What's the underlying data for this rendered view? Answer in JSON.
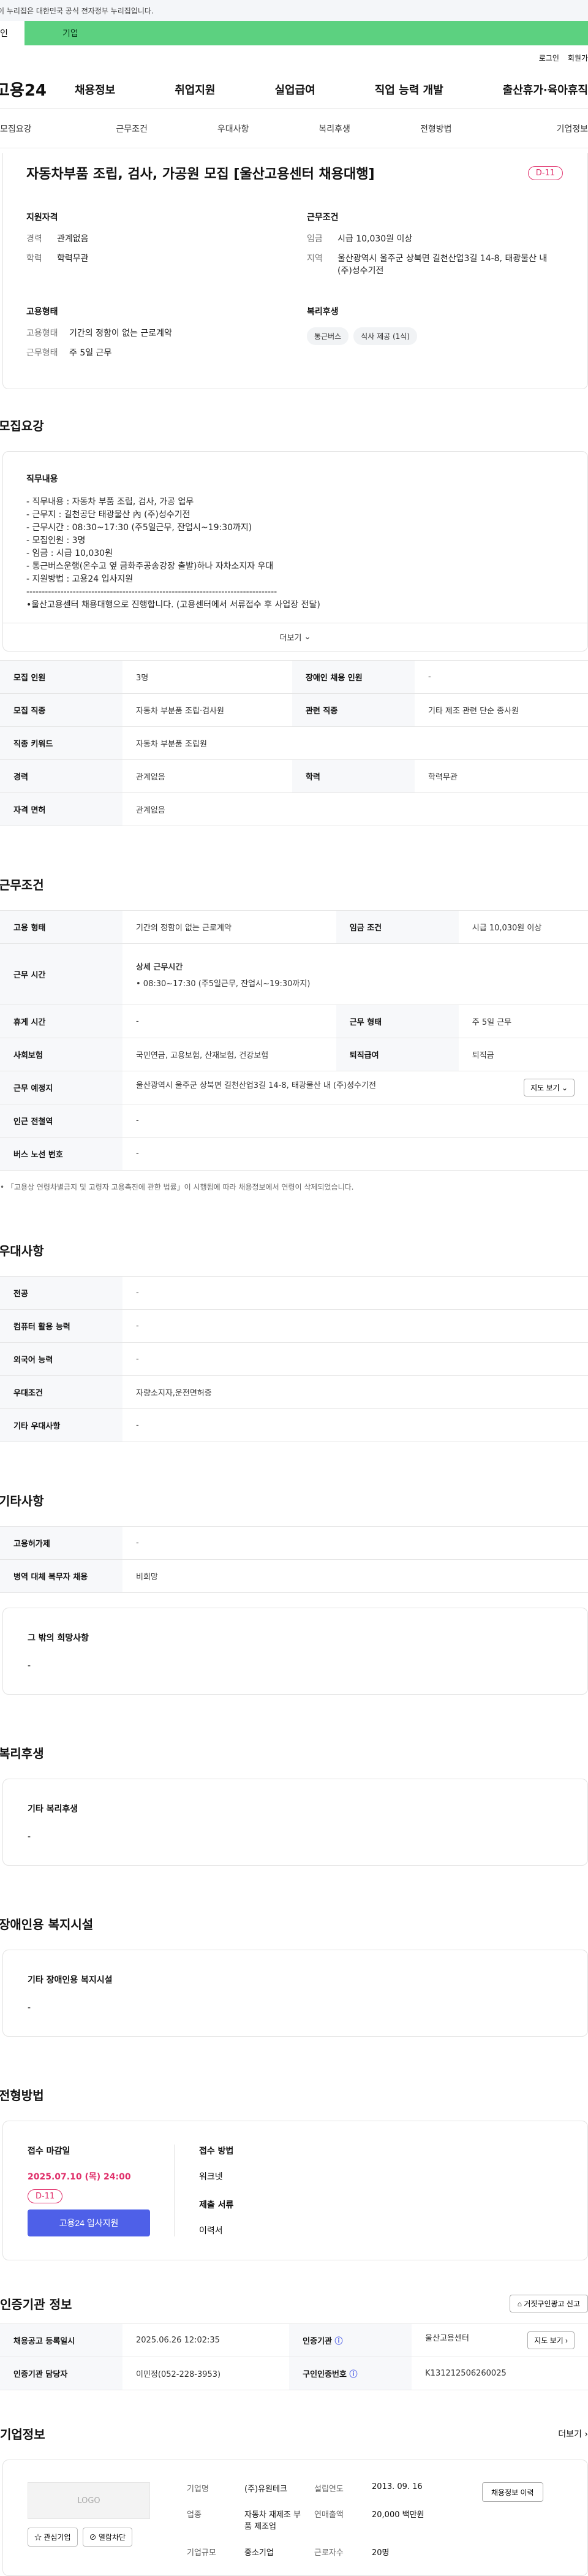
{
  "gov_notice": "이 누리집은 대한민국 공식 전자정부 누리집입니다.",
  "top_tabs": [
    "인",
    "기업"
  ],
  "utility": [
    "로그인",
    "회원가"
  ],
  "logo": "고용24",
  "gnb": [
    "채용정보",
    "취업지원",
    "실업급여",
    "직업 능력 개발",
    "출산휴가·육아휴직"
  ],
  "anchor_tabs": [
    "모집요강",
    "근무조건",
    "우대사항",
    "복리후생",
    "전형방법",
    "기업정보"
  ],
  "summary": {
    "title": "자동차부품 조립, 검사, 가공원 모집 [울산고용센터 채용대행]",
    "dday": "D-11",
    "qual_title": "지원자격",
    "qual": [
      {
        "k": "경력",
        "v": "관계없음"
      },
      {
        "k": "학력",
        "v": "학력무관"
      }
    ],
    "cond_title": "근무조건",
    "cond": [
      {
        "k": "임금",
        "v": "시급 10,030원 이상"
      },
      {
        "k": "지역",
        "v": "울산광역시 울주군 상북면 길천산업3길 14-8, 태광물산 내 (주)성수기전"
      }
    ],
    "emp_title": "고용형태",
    "emp": [
      {
        "k": "고용형태",
        "v": "기간의 정함이 없는 근로계약"
      },
      {
        "k": "근무형태",
        "v": "주 5일 근무"
      }
    ],
    "welfare_title": "복리후생",
    "welfare_tags": [
      "통근버스",
      "식사 제공 (1식)"
    ]
  },
  "recruit": {
    "section_title": "모집요강",
    "job_title": "직무내용",
    "job_text": "- 직무내용 : 자동차 부품 조립, 검사, 가공 업무\n- 근무지 : 길천공단 태광물산 內 (주)성수기전\n- 근무시간 : 08:30~17:30 (주5일근무, 잔업시~19:30까지)\n- 모집인원 : 3명\n- 임금 : 시급 10,030원\n- 통근버스운행(온수고 옆 금화주공송강장 출발)하나 자차소지자 우대\n- 지원방법 : 고용24 입사지원\n---------------------------------------------------------------------------------\n•울산고용센터 채용대행으로 진행합니다. (고용센터에서 서류접수 후 사업장 전달)",
    "more": "더보기",
    "rows": [
      {
        "h1": "모집 인원",
        "v1": "3명",
        "h2": "장애인 채용 인원",
        "v2": "-"
      },
      {
        "h1": "모집 직종",
        "v1": "자동차 부분품 조립·검사원",
        "h2": "관련 직종",
        "v2": "기타 제조 관련 단순 종사원"
      },
      {
        "h1": "직종 키워드",
        "v1": "자동차 부분품 조립원"
      },
      {
        "h1": "경력",
        "v1": "관계없음",
        "h2": "학력",
        "v2": "학력무관"
      },
      {
        "h1": "자격 면허",
        "v1": "관계없음"
      }
    ]
  },
  "work": {
    "section_title": "근무조건",
    "emp_h": "고용 형태",
    "emp_v": "기간의 정함이 없는 근로계약",
    "wage_h": "임금 조건",
    "wage_v": "시급 10,030원 이상",
    "time_h": "근무 시간",
    "time_sub": "상세 근무시간",
    "time_v": "• 08:30~17:30 (주5일근무, 잔업시~19:30까지)",
    "rest_h": "휴게 시간",
    "rest_v": "-",
    "type_h": "근무 형태",
    "type_v": "주 5일 근무",
    "ins_h": "사회보험",
    "ins_v": "국민연금, 고용보험, 산재보험, 건강보험",
    "ret_h": "퇴직급여",
    "ret_v": "퇴직금",
    "place_h": "근무 예정지",
    "place_v": "울산광역시 울주군 상북면 길천산업3길 14-8, 태광물산 내 (주)성수기전",
    "map_btn": "지도 보기",
    "sub_h": "인근 전철역",
    "sub_v": "-",
    "bus_h": "버스 노선 번호",
    "bus_v": "-",
    "note": "「고용상 연령차별금지 및 고령자 고용촉진에 관한 법률」이 시행됨에 따라 채용정보에서 연령이 삭제되었습니다."
  },
  "pref": {
    "section_title": "우대사항",
    "rows": [
      {
        "h": "전공",
        "v": "-"
      },
      {
        "h": "컴퓨터 활용 능력",
        "v": "-"
      },
      {
        "h": "외국어 능력",
        "v": "-"
      },
      {
        "h": "우대조건",
        "v": "자량소지자,운전면허증"
      },
      {
        "h": "기타 우대사항",
        "v": "-"
      }
    ]
  },
  "etc": {
    "section_title": "기타사항",
    "rows": [
      {
        "h": "고용허가제",
        "v": "-"
      },
      {
        "h": "병역 대체 복무자 채용",
        "v": "비희망"
      }
    ],
    "box_title": "그 밖의 희망사항",
    "box_v": "-"
  },
  "welfare": {
    "section_title": "복리후생",
    "box_title": "기타 복리후생",
    "box_v": "-"
  },
  "disabled": {
    "section_title": "장애인용 복지시설",
    "box_title": "기타 장애인용 복지시설",
    "box_v": "-"
  },
  "selection": {
    "section_title": "전형방법",
    "deadline_h": "접수 마감일",
    "deadline_v": "2025.07.10 (목) 24:00",
    "dday": "D-11",
    "apply_btn": "고용24 입사지원",
    "method_h": "접수 방법",
    "method_v": "워크넷",
    "docs_h": "제출 서류",
    "docs_v": "이력서"
  },
  "cert": {
    "section_title": "인증기관 정보",
    "report_btn": "거짓구인광고 신고",
    "reg_h": "채용공고 등록일시",
    "reg_v": "2025.06.26 12:02:35",
    "org_h": "인증기관",
    "org_v": "울산고용센터",
    "org_btn": "지도 보기",
    "mgr_h": "인증기관 담당자",
    "mgr_v": "이민정(052-228-3953)",
    "num_h": "구인인증번호",
    "num_v": "K131212506260025"
  },
  "company": {
    "section_title": "기업정보",
    "more": "더보기",
    "logo": "LOGO",
    "btn_fav": "관심기업",
    "btn_block": "열람차단",
    "view_btn": "채용정보 이력",
    "name_k": "기업명",
    "name_v": "(주)유원테크",
    "year_k": "설립연도",
    "year_v": "2013. 09. 16",
    "ind_k": "업종",
    "ind_v": "자동차 재제조 부품 제조업",
    "sales_k": "연매출액",
    "sales_v": "20,000 백만원",
    "size_k": "기업규모",
    "size_v": "중소기업",
    "emp_k": "근로자수",
    "emp_v": "20명"
  }
}
